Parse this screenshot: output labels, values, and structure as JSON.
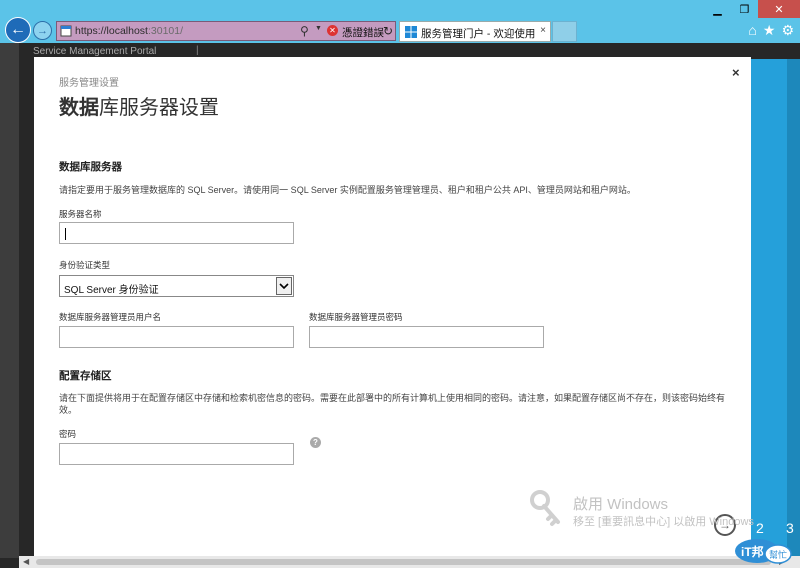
{
  "browser": {
    "url_host": "https://localhost",
    "url_port": ":30101/",
    "cert_text": "憑證錯誤",
    "tab_title": "服务管理门户 - 欢迎使用",
    "tab_close": "×",
    "window_min": "▁",
    "window_max": "❐",
    "window_close": "✕"
  },
  "page_bg": {
    "portal_title": "Service Management Portal",
    "separator": "|"
  },
  "modal": {
    "breadcrumb": "服务管理设置",
    "title_bold": "数据",
    "title_rest": "库服务器设置",
    "close": "×",
    "db_section": {
      "heading": "数据库服务器",
      "description": "请指定要用于服务管理数据库的 SQL Server。请使用同一 SQL Server 实例配置服务管理管理员、租户和租户公共 API、管理员网站和租户网站。",
      "server_name_label": "服务器名称",
      "server_name_value": "",
      "auth_type_label": "身份验证类型",
      "auth_type_value": "SQL Server 身份验证",
      "admin_user_label": "数据库服务器管理员用户名",
      "admin_user_value": "",
      "admin_pwd_label": "数据库服务器管理员密码",
      "admin_pwd_value": ""
    },
    "config_section": {
      "heading": "配置存储区",
      "description": "请在下面提供将用于在配置存储区中存储和检索机密信息的密码。需要在此部署中的所有计算机上使用相同的密码。请注意，如果配置存储区尚不存在，则该密码始终有效。",
      "password_label": "密码",
      "password_value": ""
    }
  },
  "watermark": {
    "line1": "啟用 Windows",
    "line2": "移至 [重要訊息中心] 以啟用 Windows"
  },
  "pager": {
    "current": "2",
    "next": "3"
  },
  "badge": {
    "text1": "iT邦",
    "text2": "幫忙"
  },
  "colors": {
    "chrome": "#5bc3e8",
    "address_bar": "#c49bc0",
    "panel_blue": "#25a0da"
  }
}
